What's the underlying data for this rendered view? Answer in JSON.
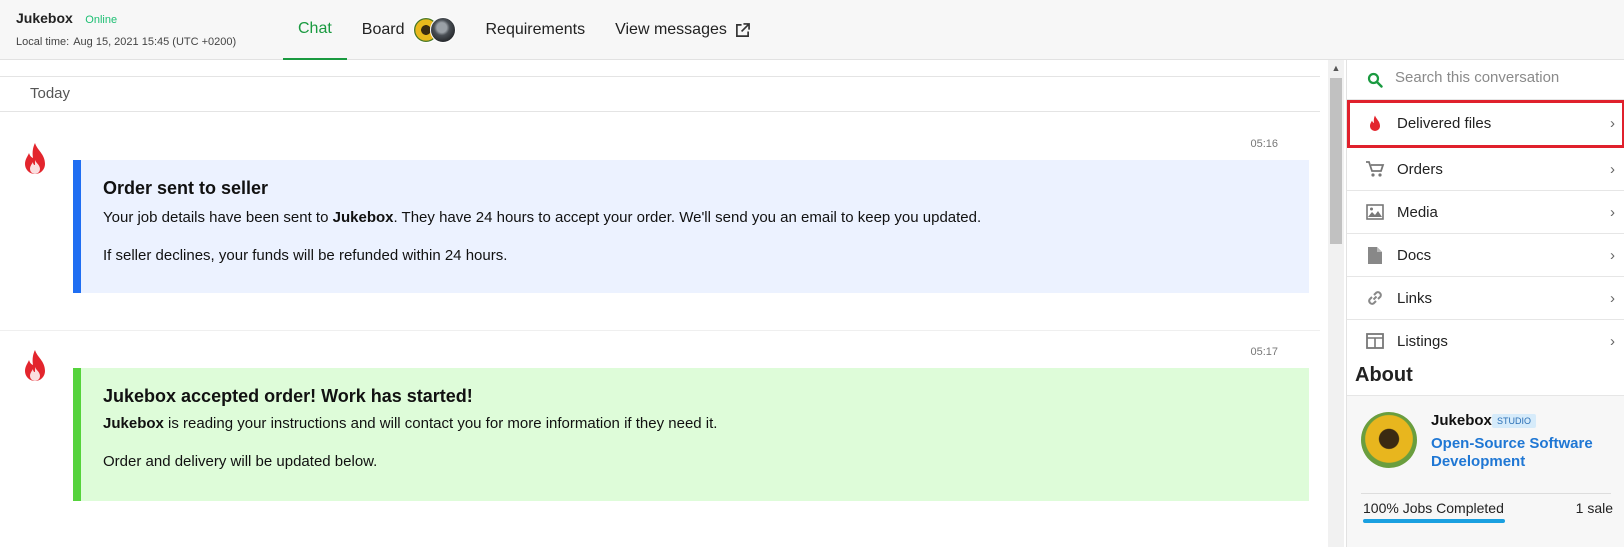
{
  "header": {
    "contact_name": "Jukebox",
    "status": "Online",
    "local_time_label": "Local time:",
    "local_time_value": "Aug 15, 2021 15:45 (UTC +0200)",
    "tabs": [
      {
        "label": "Chat",
        "active": true
      },
      {
        "label": "Board",
        "active": false
      },
      {
        "label": "Requirements",
        "active": false
      },
      {
        "label": "View messages",
        "active": false
      }
    ],
    "accent_color": "#1a9a40"
  },
  "chat": {
    "day_separator": "Today",
    "messages": [
      {
        "time": "05:16",
        "title": "Order sent to seller",
        "line1_pre": "Your job details have been sent to ",
        "line1_bold": "Jukebox",
        "line1_post": ". They have 24 hours to accept your order. We'll send you an email to keep you updated.",
        "line2": "If seller declines, your funds will be refunded within 24 hours.",
        "accent": "#1f6ef2"
      },
      {
        "time": "05:17",
        "title_bold": "Jukebox",
        "title_rest": " accepted order! Work has started!",
        "line1_bold": "Jukebox",
        "line1_post": " is reading your instructions and will contact you for more information if they need it.",
        "line2": "Order and delivery will be updated below.",
        "accent": "#55d33c"
      }
    ]
  },
  "sidebar": {
    "search_placeholder": "Search this conversation",
    "items": [
      {
        "label": "Delivered files",
        "icon": "flame-icon",
        "highlighted": true
      },
      {
        "label": "Orders",
        "icon": "cart-icon"
      },
      {
        "label": "Media",
        "icon": "image-icon"
      },
      {
        "label": "Docs",
        "icon": "document-icon"
      },
      {
        "label": "Links",
        "icon": "link-icon"
      },
      {
        "label": "Listings",
        "icon": "listings-icon"
      }
    ],
    "about": {
      "title": "About",
      "seller_name": "Jukebox",
      "badge": "STUDIO",
      "category": "Open-Source Software Development",
      "jobs_completed": "100% Jobs Completed",
      "jobs_completed_fraction": 1.0,
      "sales": "1 sale"
    }
  }
}
